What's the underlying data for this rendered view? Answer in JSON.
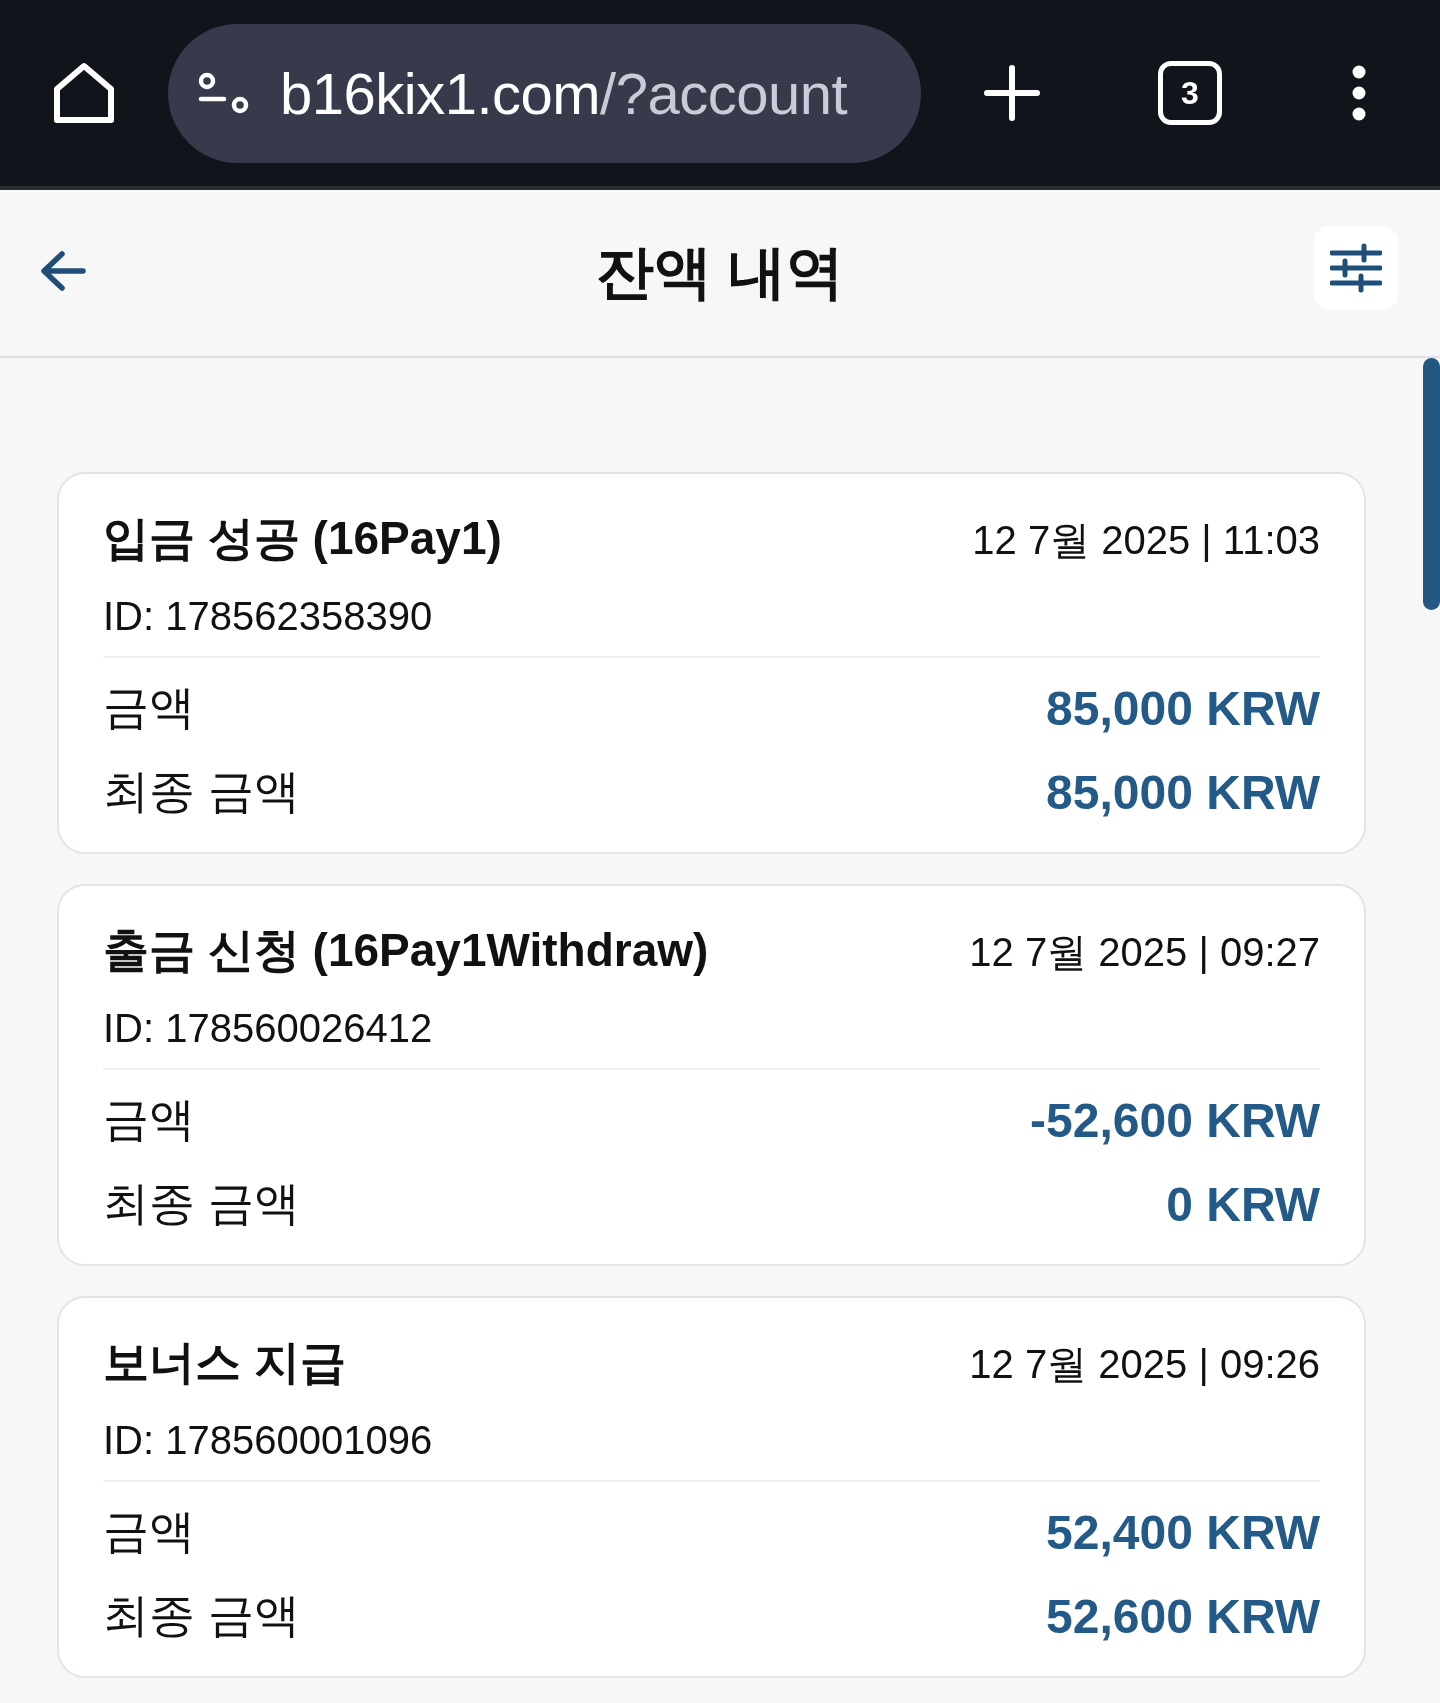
{
  "browser": {
    "url": {
      "host": "b16kix1.com",
      "path": "/?account"
    },
    "tab_count": "3"
  },
  "header": {
    "title": "잔액 내역"
  },
  "transactions": [
    {
      "title": "입금 성공 (16Pay1)",
      "datetime": "12 7월 2025 | 11:03",
      "id": "ID: 178562358390",
      "rows": [
        {
          "label": "금액",
          "value": "85,000 KRW"
        },
        {
          "label": "최종 금액",
          "value": "85,000 KRW"
        }
      ]
    },
    {
      "title": "출금 신청 (16Pay1Withdraw)",
      "datetime": "12 7월 2025 | 09:27",
      "id": "ID: 178560026412",
      "rows": [
        {
          "label": "금액",
          "value": "-52,600 KRW"
        },
        {
          "label": "최종 금액",
          "value": "0 KRW"
        }
      ]
    },
    {
      "title": "보너스 지급",
      "datetime": "12 7월 2025 | 09:26",
      "id": "ID: 178560001096",
      "rows": [
        {
          "label": "금액",
          "value": "52,400 KRW"
        },
        {
          "label": "최종 금액",
          "value": "52,600 KRW"
        }
      ]
    }
  ]
}
